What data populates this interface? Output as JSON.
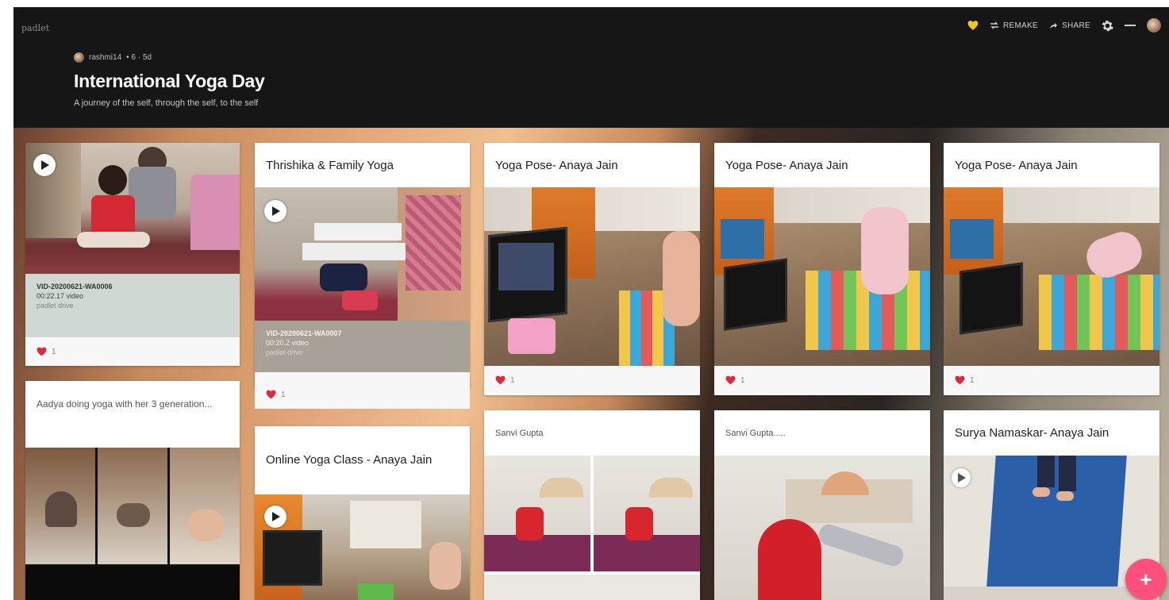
{
  "app": {
    "brand": "padlet"
  },
  "header": {
    "actions": {
      "remake": "REMAKE",
      "share": "SHARE"
    },
    "author": "rashmi14",
    "stats": "• 6 · 5d",
    "title": "International Yoga Day",
    "subtitle": "A journey of the self, through the self, to the self"
  },
  "colors": {
    "accent": "#ff4f7c",
    "header_bg": "#161616",
    "reaction_heart": "#e0283b",
    "heart_yellow": "#f5c518"
  },
  "cards": [
    {
      "attachment_name": "VID-20200621-WA0006",
      "attachment_meta": "00:22.17 video",
      "attachment_source": "padlet drive",
      "likes": "1"
    },
    {
      "title": "Thrishika & Family Yoga",
      "attachment_name": "VID-20200621-WA0007",
      "attachment_meta": "00:20.2 video",
      "attachment_source": "padlet drive",
      "likes": "1"
    },
    {
      "title": "Yoga Pose- Anaya Jain",
      "likes": "1"
    },
    {
      "title": "Yoga Pose- Anaya Jain",
      "likes": "1"
    },
    {
      "title": "Yoga Pose- Anaya Jain",
      "likes": "1"
    },
    {
      "body": "Aadya doing yoga with her 3 generation..."
    },
    {
      "title": "Online Yoga Class - Anaya Jain"
    },
    {
      "title": "Sanvi Gupta"
    },
    {
      "title": "Sanvi Gupta....."
    },
    {
      "title": "Surya Namaskar- Anaya Jain"
    }
  ],
  "fab": {
    "label": "+"
  },
  "icons": [
    "heart-icon",
    "remake-icon",
    "share-icon",
    "gear-icon",
    "more-icon",
    "avatar",
    "play-icon",
    "plus-icon"
  ]
}
